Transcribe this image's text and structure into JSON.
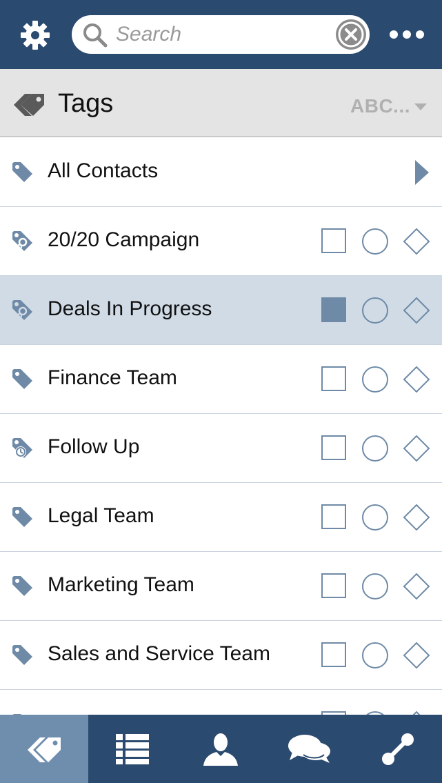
{
  "topbar": {
    "settings_icon": "gear-icon",
    "search_placeholder": "Search",
    "search_value": "",
    "clear_icon": "clear-x-icon",
    "more_icon": "more-dots-icon"
  },
  "tags_header": {
    "title": "Tags",
    "sort_label": "ABC...",
    "icon": "tags-icon"
  },
  "all_contacts": {
    "label": "All Contacts",
    "icon": "tag-icon"
  },
  "tags": [
    {
      "label": "20/20 Campaign",
      "icon": "campaign-tag-icon",
      "square_checked": false,
      "selected": false
    },
    {
      "label": "Deals In Progress",
      "icon": "campaign-tag-icon",
      "square_checked": true,
      "selected": true
    },
    {
      "label": "Finance Team",
      "icon": "tag-icon",
      "square_checked": false,
      "selected": false
    },
    {
      "label": "Follow Up",
      "icon": "clock-tag-icon",
      "square_checked": false,
      "selected": false
    },
    {
      "label": "Legal Team",
      "icon": "tag-icon",
      "square_checked": false,
      "selected": false
    },
    {
      "label": "Marketing Team",
      "icon": "tag-icon",
      "square_checked": false,
      "selected": false
    },
    {
      "label": "Sales and Service Team",
      "icon": "tag-icon",
      "square_checked": false,
      "selected": false
    }
  ],
  "tabbar": {
    "tabs": [
      {
        "icon": "tags-icon",
        "active": true
      },
      {
        "icon": "list-icon",
        "active": false
      },
      {
        "icon": "contact-icon",
        "active": false
      },
      {
        "icon": "chat-icon",
        "active": false
      },
      {
        "icon": "connection-icon",
        "active": false
      }
    ]
  },
  "colors": {
    "header_bg": "#2b4a6f",
    "accent": "#6e8aa6",
    "selected_row": "#d0dbe6",
    "active_tab": "#6f8eae"
  }
}
